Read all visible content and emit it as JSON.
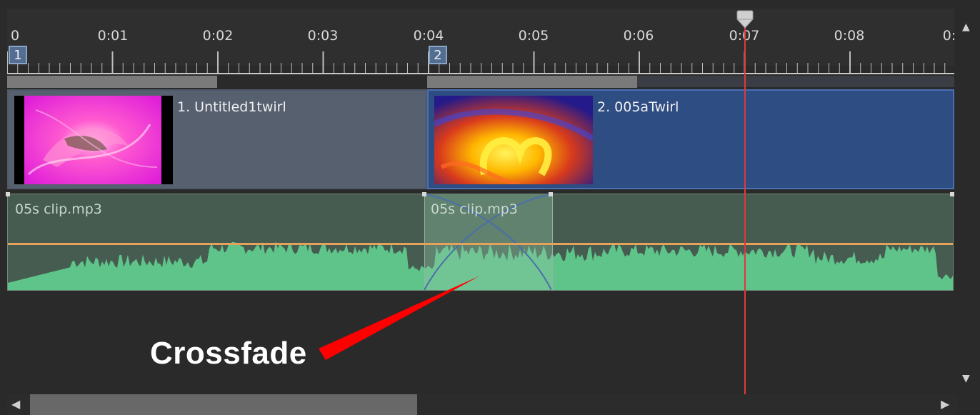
{
  "ruler": {
    "labels": [
      "0",
      "0:01",
      "0:02",
      "0:03",
      "0:04",
      "0:05",
      "0:06",
      "0:07",
      "0:08",
      "0:"
    ],
    "markers": [
      "1",
      "2"
    ]
  },
  "tracks": {
    "video": [
      {
        "title": "1. Untitled1twirl"
      },
      {
        "title": "2. 005aTwirl"
      }
    ],
    "audio": [
      {
        "title": "05s clip.mp3"
      },
      {
        "title": "05s clip.mp3"
      }
    ]
  },
  "annotation": {
    "text": "Crossfade"
  },
  "colors": {
    "playhead": "#e0383c",
    "waveform": "#5fc48a",
    "volume_line": "#e6a15a",
    "annotation_arrow": "#ff0000",
    "clip2_selected": "#2e4d82"
  },
  "icons": {
    "playhead_handle": "playhead-handle-icon",
    "scroll_left": "arrow-left-icon",
    "scroll_right": "arrow-right-icon",
    "scroll_up": "arrow-up-icon",
    "scroll_down": "arrow-down-icon"
  }
}
